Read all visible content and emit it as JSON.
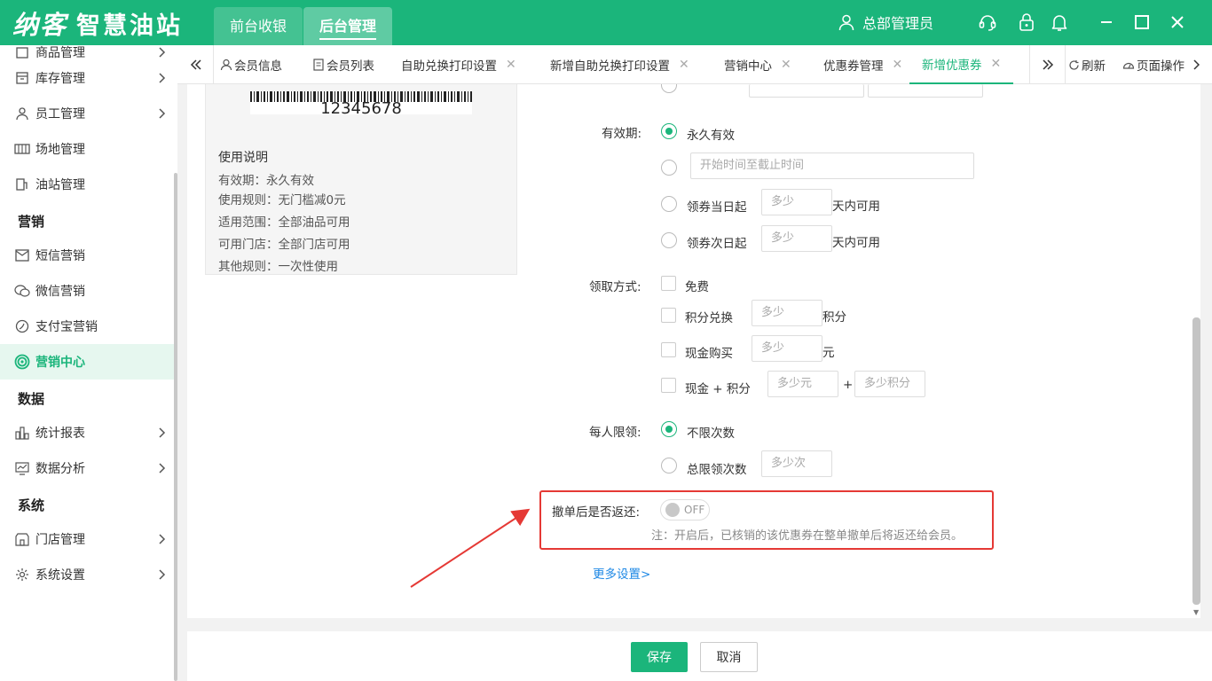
{
  "app": {
    "logo_text": "纳客",
    "brand_text": "智慧油站",
    "top_tabs": [
      "前台收银",
      "后台管理"
    ],
    "user_name": "总部管理员"
  },
  "sidebar": {
    "items": [
      {
        "label": "商品管理",
        "icon": "goods-icon"
      },
      {
        "label": "库存管理",
        "icon": "inventory-icon"
      },
      {
        "label": "员工管理",
        "icon": "user-icon"
      },
      {
        "label": "场地管理",
        "icon": "venue-icon"
      },
      {
        "label": "油站管理",
        "icon": "station-icon"
      },
      {
        "label": "短信营销",
        "icon": "mail-icon"
      },
      {
        "label": "微信营销",
        "icon": "wechat-icon"
      },
      {
        "label": "支付宝营销",
        "icon": "alipay-icon"
      },
      {
        "label": "营销中心",
        "icon": "target-icon"
      },
      {
        "label": "统计报表",
        "icon": "bar-chart-icon"
      },
      {
        "label": "数据分析",
        "icon": "analysis-icon"
      },
      {
        "label": "门店管理",
        "icon": "store-icon"
      },
      {
        "label": "系统设置",
        "icon": "gear-icon"
      }
    ],
    "groups": [
      "营销",
      "数据",
      "系统"
    ]
  },
  "tabs": {
    "items": [
      "会员信息",
      "会员列表",
      "自助兑换打印设置",
      "新增自助兑换打印设置",
      "营销中心",
      "优惠券管理",
      "新增优惠券"
    ],
    "refresh": "刷新",
    "page_ops": "页面操作"
  },
  "preview": {
    "barcode_number": "12345678",
    "title": "使用说明",
    "lines": [
      "有效期：永久有效",
      "使用规则：无门槛减0元",
      "适用范围：全部油品可用",
      "可用门店：全部门店可用",
      "其他规则：一次性使用"
    ]
  },
  "form": {
    "validity": {
      "label": "有效期:",
      "opt_forever": "永久有效",
      "date_range_placeholder": "开始时间至截止时间",
      "opt_same_day": "领券当日起",
      "opt_next_day": "领券次日起",
      "days_placeholder": "多少",
      "days_suffix": "天内可用"
    },
    "claim": {
      "label": "领取方式:",
      "opt_free": "免费",
      "opt_points": "积分兑换",
      "points_placeholder": "多少",
      "points_suffix": "积分",
      "opt_cash": "现金购买",
      "cash_placeholder": "多少",
      "cash_suffix": "元",
      "opt_cash_points": "现金 + 积分",
      "cash_yuan_placeholder": "多少元",
      "plus": "+",
      "cash_points_placeholder": "多少积分"
    },
    "limit": {
      "label": "每人限领:",
      "opt_unlimited": "不限次数",
      "opt_total": "总限领次数",
      "total_placeholder": "多少次"
    },
    "refund": {
      "label": "撤单后是否返还:",
      "toggle_text": "OFF",
      "note": "注：开启后，已核销的该优惠券在整单撤单后将返还给会员。"
    },
    "more_settings": "更多设置>"
  },
  "footer": {
    "save": "保存",
    "cancel": "取消"
  },
  "colors": {
    "brand": "#1bb57b",
    "highlight": "#e53935",
    "link": "#1e88e5"
  }
}
